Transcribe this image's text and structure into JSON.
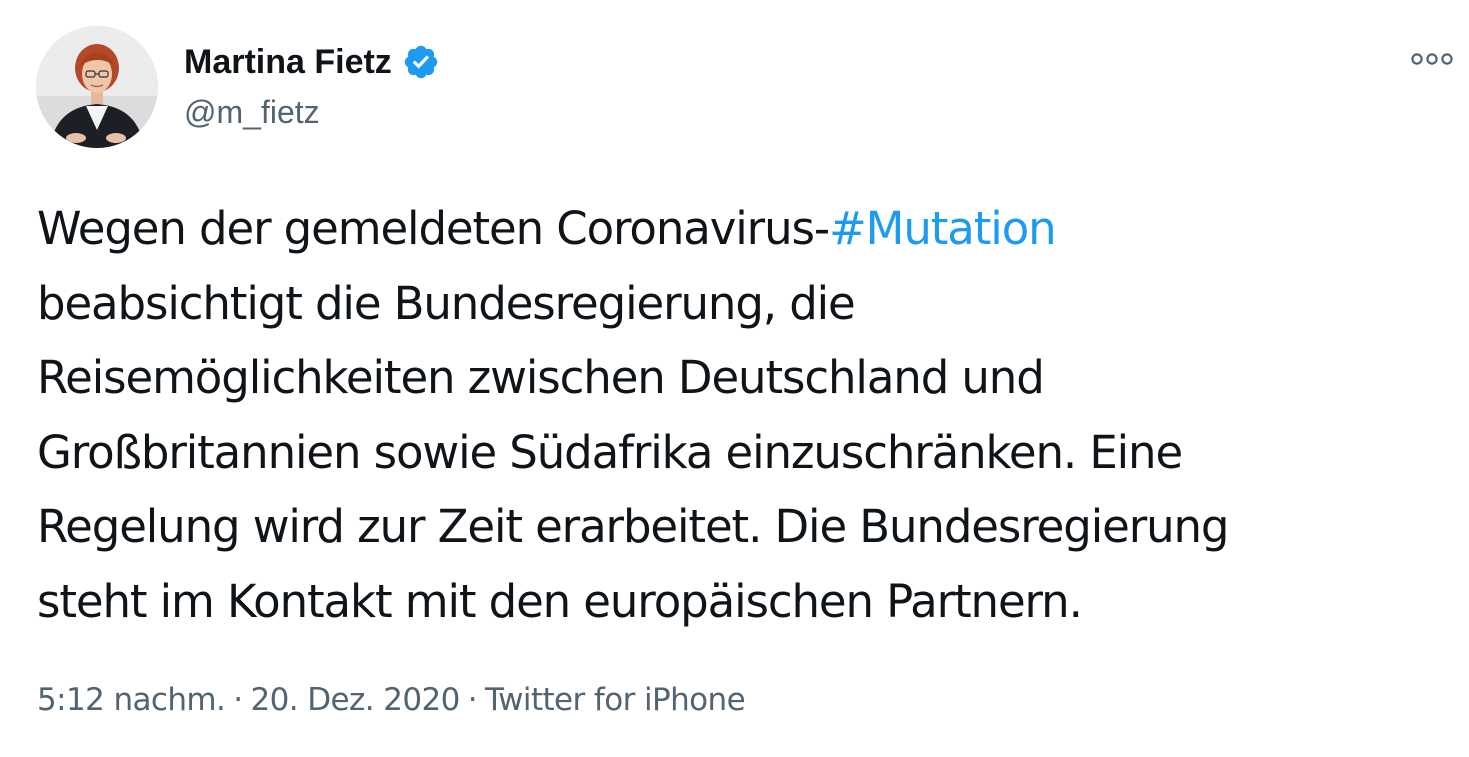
{
  "author": {
    "name": "Martina Fietz",
    "handle": "@m_fietz",
    "verified_icon": "verified-badge-icon",
    "verified_color": "#1d9bf0"
  },
  "tweet": {
    "text_before_hashtag": "Wegen der gemeldeten Coronavirus-",
    "hashtag": "#Mutation",
    "lines": [
      "beabsichtigt die Bundesregierung, die",
      "Reisemöglichkeiten zwischen Deutschland und",
      "Großbritannien sowie Südafrika einzuschränken. Eine",
      "Regelung wird zur Zeit erarbeitet. Die Bundesregierung",
      "steht im Kontakt mit den europäischen Partnern."
    ]
  },
  "meta": {
    "time": "5:12 nachm.",
    "separator": "·",
    "date": "20. Dez. 2020",
    "source": "Twitter for iPhone"
  },
  "more_icon": "more-options-icon",
  "colors": {
    "text": "#0f1419",
    "secondary": "#536471",
    "link": "#1d9bf0"
  }
}
